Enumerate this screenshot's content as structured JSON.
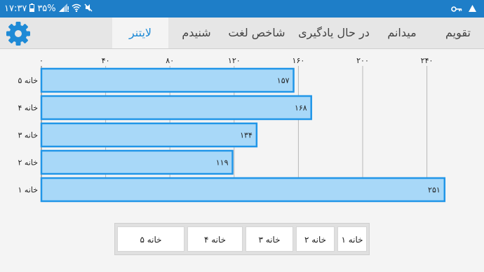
{
  "status": {
    "time": "۱۷:۳۷",
    "battery": "۳۵%"
  },
  "tabs": [
    {
      "label": "تقویم"
    },
    {
      "label": "میدانم"
    },
    {
      "label": "در حال یادگیری"
    },
    {
      "label": "شاخص لغت"
    },
    {
      "label": "شنیدم"
    },
    {
      "label": "لایتنر"
    }
  ],
  "active_tab": "لایتنر",
  "colors": {
    "statusbar": "#1e7ec8",
    "bar_fill": "#a8d8f8",
    "bar_stroke": "#2196e8",
    "active_tab_text": "#1e8ad6"
  },
  "chart_data": {
    "type": "bar",
    "orientation": "horizontal",
    "categories": [
      "خانه ۵",
      "خانه ۴",
      "خانه ۳",
      "خانه ۲",
      "خانه ۱"
    ],
    "values": [
      157,
      168,
      134,
      119,
      251
    ],
    "value_labels": [
      "۱۵۷",
      "۱۶۸",
      "۱۳۴",
      "۱۱۹",
      "۲۵۱"
    ],
    "xlim": [
      0,
      240
    ],
    "x_ticks": [
      0,
      40,
      80,
      120,
      160,
      200,
      240
    ],
    "x_tick_labels": [
      "۰",
      "۴۰",
      "۸۰",
      "۱۲۰",
      "۱۶۰",
      "۲۰۰",
      "۲۴۰"
    ],
    "grid": true,
    "tick_position": "top"
  },
  "box_buttons": [
    "خانه ۵",
    "خانه ۴",
    "خانه ۳",
    "خانه ۲",
    "خانه ۱"
  ]
}
